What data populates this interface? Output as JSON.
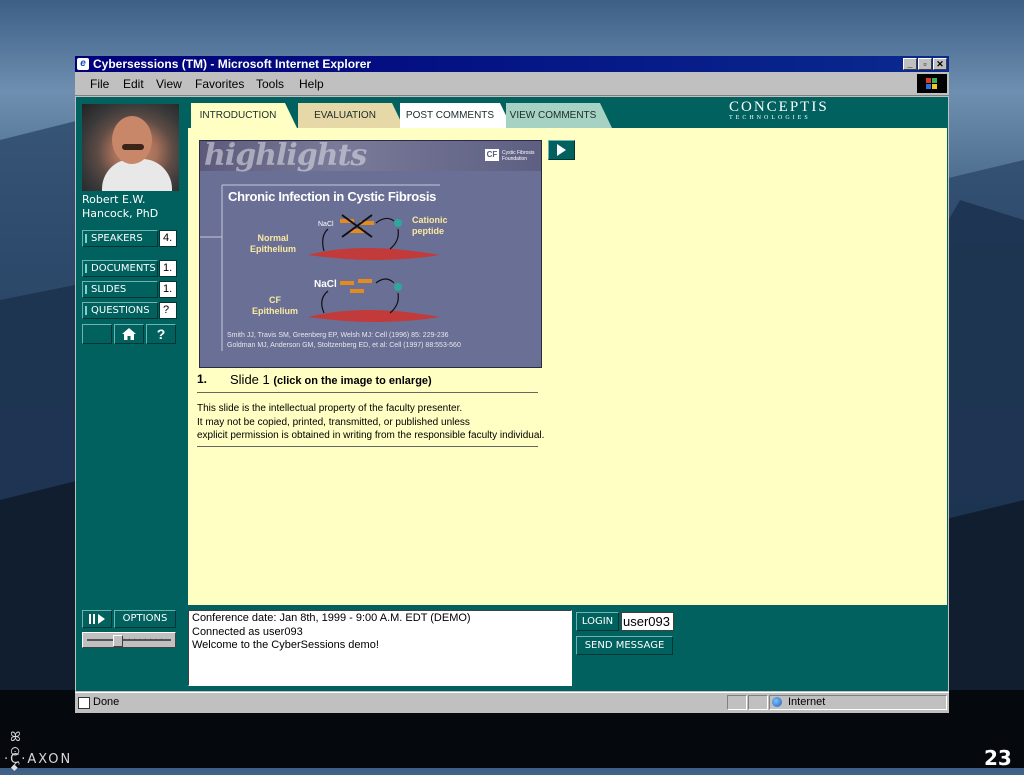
{
  "window": {
    "title": "Cybersessions (TM) - Microsoft Internet Explorer",
    "min_btn": "_",
    "max_btn": "▫",
    "close_btn": "✕"
  },
  "menu": {
    "file": "File",
    "edit": "Edit",
    "view": "View",
    "favorites": "Favorites",
    "tools": "Tools",
    "help": "Help"
  },
  "sidebar": {
    "speaker_name_line1": "Robert E.W.",
    "speaker_name_line2": "Hancock, PhD",
    "buttons": [
      {
        "label": "SPEAKERS",
        "count": "4."
      },
      {
        "label": "DOCUMENTS",
        "count": "1."
      },
      {
        "label": "SLIDES",
        "count": "1."
      },
      {
        "label": "QUESTIONS",
        "count": "?"
      }
    ],
    "icons": [
      "home-icon",
      "help-icon"
    ],
    "help_glyph": "?"
  },
  "tabs": [
    {
      "label": "INTRODUCTION",
      "color": "#ffffc4"
    },
    {
      "label": "EVALUATION",
      "color": "#e7d8a7"
    },
    {
      "label": "POST COMMENTS",
      "color": "#ffffff"
    },
    {
      "label": "VIEW COMMENTS",
      "color": "#a6d2c3"
    }
  ],
  "brand": {
    "name": "CONCEPTIS",
    "sub": "TECHNOLOGIES"
  },
  "slide": {
    "banner": "highlights",
    "logo_cf": "CF",
    "logo_text": "Cystic Fibrosis Foundation",
    "title": "Chronic Infection in Cystic Fibrosis",
    "normal_label_1": "Normal",
    "normal_label_2": "Epithelium",
    "cf_label_1": "CF",
    "cf_label_2": "Epithelium",
    "nacl_small": "NaCl",
    "nacl_large": "NaCl",
    "cationic_1": "Cationic",
    "cationic_2": "peptide",
    "ref1": "Smith JJ, Travis SM, Greenberg EP, Welsh MJ: Cell (1996) 85: 229-236",
    "ref2": "Goldman MJ, Anderson GM, Stoltzenberg ED, et al: Cell (1997) 88:553-560"
  },
  "caption": {
    "number": "1.",
    "title": "Slide 1",
    "hint": "(click on the image to enlarge)"
  },
  "notice": {
    "line1": "This slide is the intellectual property of the faculty presenter.",
    "line2": "It may not be copied, printed, transmitted, or published unless",
    "line3": "explicit permission is obtained in writing from the responsible faculty individual."
  },
  "controls": {
    "options_label": "OPTIONS",
    "login_label": "LOGIN",
    "login_value": "user093",
    "send_label": "SEND MESSAGE"
  },
  "messages": {
    "line1": "Conference date: Jan 8th, 1999 - 9:00 A.M. EDT (DEMO)",
    "line2": "Connected as user093",
    "line3": "Welcome to the CyberSessions demo!"
  },
  "status": {
    "text": "Done",
    "zone": "Internet"
  },
  "footer": {
    "logo": "AXON",
    "page_number": "23"
  }
}
